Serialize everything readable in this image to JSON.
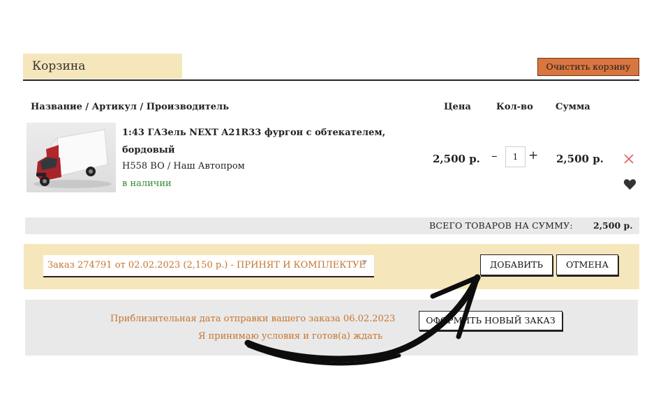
{
  "cart": {
    "title": "Корзина",
    "clear_label": "Очистить корзину"
  },
  "columns": {
    "name": "Название / Артикул / Производитель",
    "price": "Цена",
    "qty": "Кол-во",
    "sum": "Сумма"
  },
  "item": {
    "title_line1": "1:43 ГАЗель NEXT A21R33 фургон с обтекателем,",
    "title_line2": "бордовый",
    "sku": "H558 BO / Наш Автопром",
    "stock": "в наличии",
    "price": "2,500 р.",
    "qty": "1",
    "minus": "–",
    "plus": "+",
    "sum": "2,500 р.",
    "image_icon": "truck-image",
    "remove_icon": "close-icon",
    "fav_icon": "heart-icon"
  },
  "total": {
    "label": "ВСЕГО ТОВАРОВ НА СУММУ:",
    "value": "2,500 р."
  },
  "order": {
    "selected": "Заказ 274791 от 02.02.2023 (2,150 р.) - ПРИНЯТ И КОМПЛЕКТУЕ",
    "add_label": "ДОБАВИТЬ",
    "cancel_label": "ОТМЕНА"
  },
  "shipping": {
    "date_text": "Приблизительная дата отправки вашего заказа 06.02.2023",
    "agree_text": "Я принимаю условия и готов(а) ждать",
    "new_order_label": "ОФОРМИТЬ НОВЫЙ ЗАКАЗ"
  },
  "colors": {
    "accent": "#d9763f",
    "highlight": "#f5e6bb",
    "link": "#c6742e",
    "in_stock": "#2f8a2f",
    "remove": "#e06060"
  }
}
